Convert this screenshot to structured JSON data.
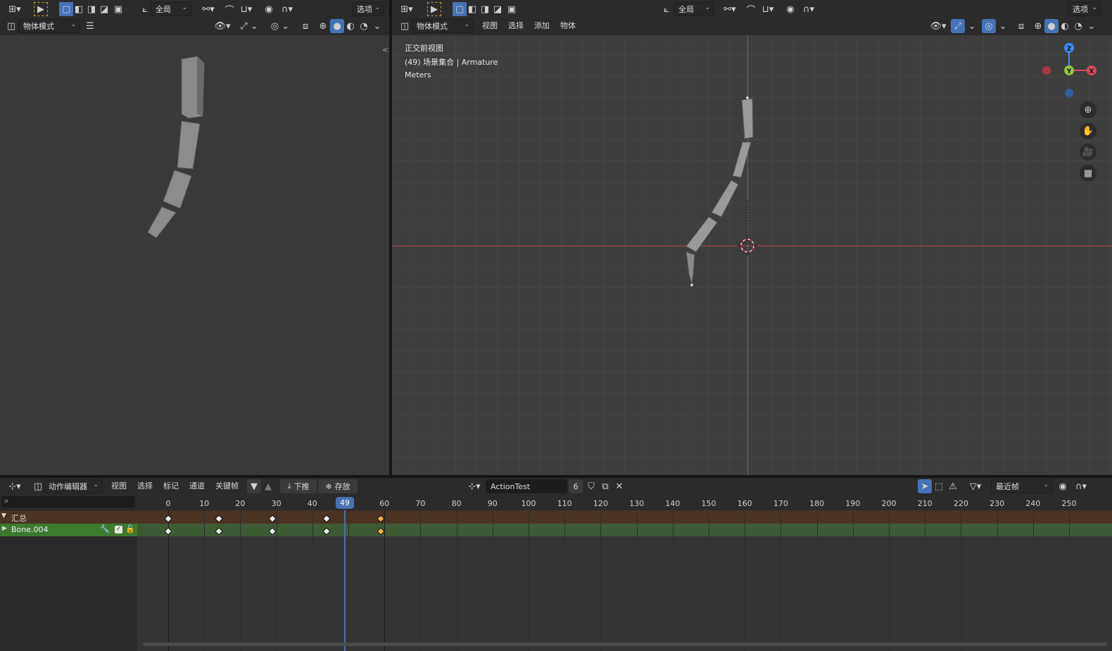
{
  "colors": {
    "accent": "#4772b3",
    "x_axis": "#d94b5b",
    "y_axis": "#8dc63f",
    "z_axis": "#3b8cf0",
    "keyframe_selected": "#f4b43a",
    "summary_row": "#4a3322",
    "channel_row": "#3e5a34"
  },
  "left_view": {
    "header": {
      "mode": "物体模式",
      "orientation": "全局",
      "options": "选项"
    }
  },
  "right_view": {
    "header": {
      "orientation": "全局",
      "options": "选项",
      "mode": "物体模式",
      "menus": [
        "视图",
        "选择",
        "添加",
        "物体"
      ]
    },
    "overlay": {
      "view_name": "正交前视图",
      "collection": "(49) 场景集合 | Armature",
      "units": "Meters"
    },
    "gizmo": {
      "z": "Z",
      "y": "Y",
      "x": "X"
    }
  },
  "dopesheet": {
    "editor_type": "动作编辑器",
    "menus": [
      "视图",
      "选择",
      "标记",
      "通道",
      "关键帧"
    ],
    "push_down": "下推",
    "stash": "存放",
    "action_name": "ActionTest",
    "users": "6",
    "snap": "最近帧",
    "current_frame": "49",
    "frame_ticks": [
      "0",
      "10",
      "20",
      "30",
      "40",
      "",
      "60",
      "70",
      "80",
      "90",
      "100",
      "110",
      "120",
      "130",
      "140",
      "150",
      "160",
      "170",
      "180",
      "190",
      "200",
      "210",
      "220",
      "230",
      "240",
      "250"
    ],
    "channels": [
      {
        "name": "汇总",
        "kind": "summary"
      },
      {
        "name": "Bone.004",
        "kind": "bone"
      }
    ],
    "keyframes": [
      0,
      14,
      29,
      44,
      59
    ],
    "selected_keyframe": 59
  }
}
